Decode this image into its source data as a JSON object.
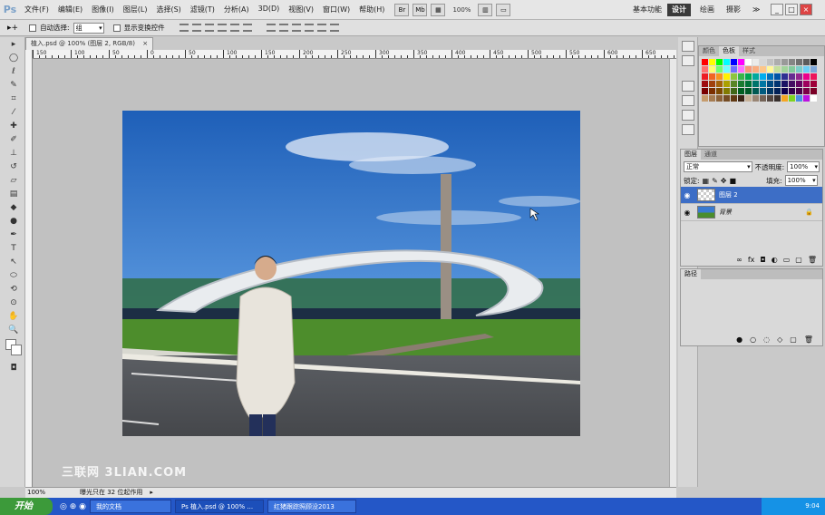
{
  "app": {
    "logo": "Ps"
  },
  "menu": [
    "文件(F)",
    "编辑(E)",
    "图像(I)",
    "图层(L)",
    "选择(S)",
    "滤镜(T)",
    "分析(A)",
    "3D(D)",
    "视图(V)",
    "窗口(W)",
    "帮助(H)"
  ],
  "menubar": {
    "zoom": "100%"
  },
  "workspaces": {
    "basic": "基本功能",
    "design": "设计",
    "painting": "绘画",
    "photography": "摄影",
    "more": "≫"
  },
  "options": {
    "auto_select_label": "自动选择:",
    "auto_select_value": "组",
    "show_transform_label": "显示变换控件"
  },
  "document": {
    "tab_title": "植入.psd @ 100% (图层 2, RGB/8)",
    "tab_close": "×"
  },
  "ruler_h": [
    "150",
    "100",
    "50",
    "0",
    "50",
    "100",
    "150",
    "200",
    "250",
    "300",
    "350",
    "400",
    "450",
    "500",
    "550",
    "600",
    "650"
  ],
  "status": {
    "zoom": "100%",
    "info": "曝光只在 32 位起作用"
  },
  "swatches_panel": {
    "tabs": [
      "颜色",
      "色板",
      "样式"
    ]
  },
  "swatch_colors": [
    "#ff0000",
    "#ffff00",
    "#00ff00",
    "#00ffff",
    "#0000ff",
    "#ff00ff",
    "#ffffff",
    "#ebebeb",
    "#d6d6d6",
    "#c2c2c2",
    "#adadad",
    "#999999",
    "#858585",
    "#707070",
    "#5c5c5c",
    "#000000",
    "#ff6f6f",
    "#ffff6f",
    "#6fff6f",
    "#6fffff",
    "#6f6fff",
    "#ff6fff",
    "#f7977a",
    "#f9ad81",
    "#fdc68a",
    "#fff79a",
    "#c4df9b",
    "#a2d39c",
    "#82ca9d",
    "#7bcdc8",
    "#6ecff6",
    "#7ea7d8",
    "#ed1c24",
    "#f26522",
    "#f7941d",
    "#fff200",
    "#8dc63f",
    "#39b54a",
    "#00a651",
    "#00a99d",
    "#00aeef",
    "#0072bc",
    "#0054a6",
    "#2e3192",
    "#662d91",
    "#92278f",
    "#ec008c",
    "#ed145b",
    "#9e0b0f",
    "#a0410d",
    "#a36209",
    "#aba000",
    "#598527",
    "#1a7b30",
    "#007236",
    "#00746b",
    "#0076a3",
    "#004a80",
    "#003471",
    "#1b1464",
    "#440e62",
    "#630460",
    "#9e005d",
    "#9e0039",
    "#790000",
    "#7b2e00",
    "#7d4900",
    "#827b00",
    "#406618",
    "#005e20",
    "#005826",
    "#005952",
    "#005b7f",
    "#003663",
    "#002157",
    "#0d004c",
    "#32004b",
    "#4b0049",
    "#7b0046",
    "#7a0026",
    "#c69c6d",
    "#a67c52",
    "#8c6239",
    "#754c24",
    "#603913",
    "#3c2415",
    "#c7b299",
    "#998675",
    "#736357",
    "#534741",
    "#362f2d",
    "#f5a623",
    "#7ed321",
    "#4a90e2",
    "#bd10e0",
    "#ffffff"
  ],
  "layers_panel": {
    "tabs": [
      "图层",
      "通道"
    ],
    "blend_mode": "正常",
    "opacity_label": "不透明度:",
    "opacity": "100%",
    "lock_label": "锁定:",
    "fill_label": "填充:",
    "fill": "100%",
    "layers": [
      {
        "name": "图层 2",
        "selected": true
      },
      {
        "name": "背景",
        "selected": false
      }
    ]
  },
  "paths_panel": {
    "tab": "路径"
  },
  "taskbar": {
    "start": "开始",
    "items": [
      "我的文档",
      "Ps 植入.psd @ 100% ...",
      "红猪跟踪照顾没2013"
    ],
    "time": "9:04"
  },
  "watermark": "三联网 3LIAN.COM",
  "colors": {
    "selection": "#3d6ec6",
    "taskbar": "#2457c7",
    "start": "#3c9a3a",
    "sky": "#2f74c9"
  }
}
